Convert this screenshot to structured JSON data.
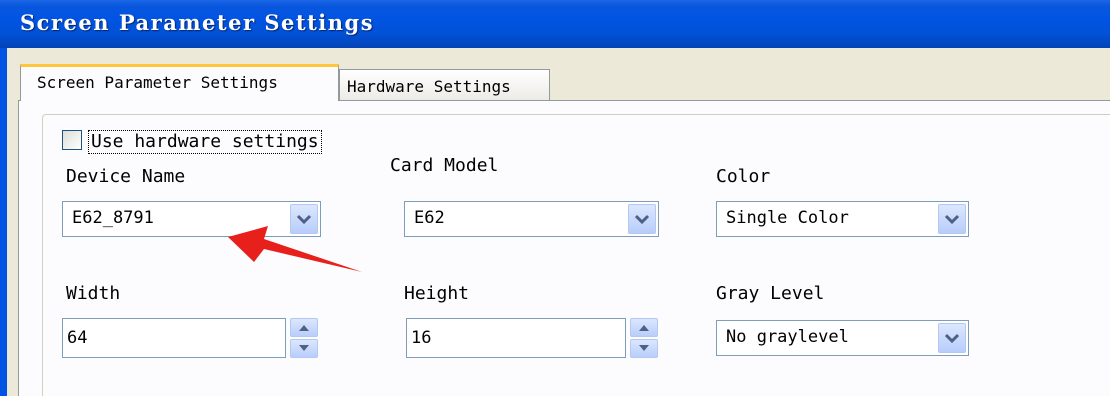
{
  "window": {
    "title": "Screen Parameter Settings"
  },
  "tabs": [
    {
      "label": "Screen Parameter Settings",
      "active": true
    },
    {
      "label": "Hardware Settings",
      "active": false
    }
  ],
  "use_hardware": {
    "label": "Use hardware settings",
    "checked": false
  },
  "fields": {
    "device_name": {
      "label": "Device Name",
      "value": "E62_8791"
    },
    "card_model": {
      "label": "Card Model",
      "value": "E62"
    },
    "color": {
      "label": "Color",
      "value": "Single Color"
    },
    "width": {
      "label": "Width",
      "value": "64"
    },
    "height": {
      "label": "Height",
      "value": "16"
    },
    "gray_level": {
      "label": "Gray Level",
      "value": "No graylevel"
    }
  },
  "annotation": {
    "arrow_color": "#e8201c"
  },
  "colors": {
    "titlebar": "#0054e3",
    "tab_highlight": "#ffc83c",
    "control_border": "#7f9db9"
  }
}
